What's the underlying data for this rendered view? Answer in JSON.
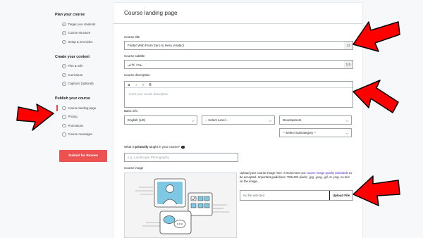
{
  "sidebar": {
    "sections": [
      {
        "title": "Plan your course",
        "items": [
          {
            "label": "Target your students",
            "checked": true
          },
          {
            "label": "Course structure",
            "checked": true
          },
          {
            "label": "Setup & test video",
            "checked": true
          }
        ]
      },
      {
        "title": "Create your content",
        "items": [
          {
            "label": "Film & edit",
            "checked": true
          },
          {
            "label": "Curriculum",
            "checked": true
          },
          {
            "label": "Captions (optional)",
            "checked": true
          }
        ]
      },
      {
        "title": "Publish your course",
        "items": [
          {
            "label": "Course landing page",
            "checked": false,
            "active": true
          },
          {
            "label": "Pricing",
            "checked": false
          },
          {
            "label": "Promotions",
            "checked": false
          },
          {
            "label": "Course messages",
            "checked": false
          }
        ]
      }
    ],
    "submit_label": "Submit for Review"
  },
  "page": {
    "title": "Course landing page",
    "course_title": {
      "label": "Course title",
      "value": "Flutter Web From Zero to Hero (Arabic)",
      "count": "22"
    },
    "course_subtitle": {
      "label": "Course subtitle",
      "value": "يوحة تعاس",
      "count": "110"
    },
    "course_description": {
      "label": "Course description",
      "placeholder": "Insert your course description.",
      "toolbar": [
        "B",
        "I",
        "≡",
        "≣"
      ]
    },
    "basic_info": {
      "label": "Basic info",
      "language": "English (US)",
      "level": "-- Select Level --",
      "category": "Development",
      "subcategory": "-- Select Subcategory --"
    },
    "primary_taught": {
      "label_pre": "What is ",
      "label_bold": "primarily",
      "label_post": " taught in your course?",
      "placeholder": "e.g. Landscape Photography"
    },
    "course_image": {
      "label": "Course image",
      "help_pre": "Upload your course image here. It must meet our ",
      "help_link": "course image quality standards",
      "help_post": " to be accepted. Important guidelines: 750x422 pixels; .jpg, .jpeg,. gif, or .png. no text on the image.",
      "no_file": "No file selected",
      "upload_label": "Upload File"
    }
  },
  "colors": {
    "accent": "#ec5252",
    "arrow": "#ff0000",
    "link": "#5624d0"
  }
}
